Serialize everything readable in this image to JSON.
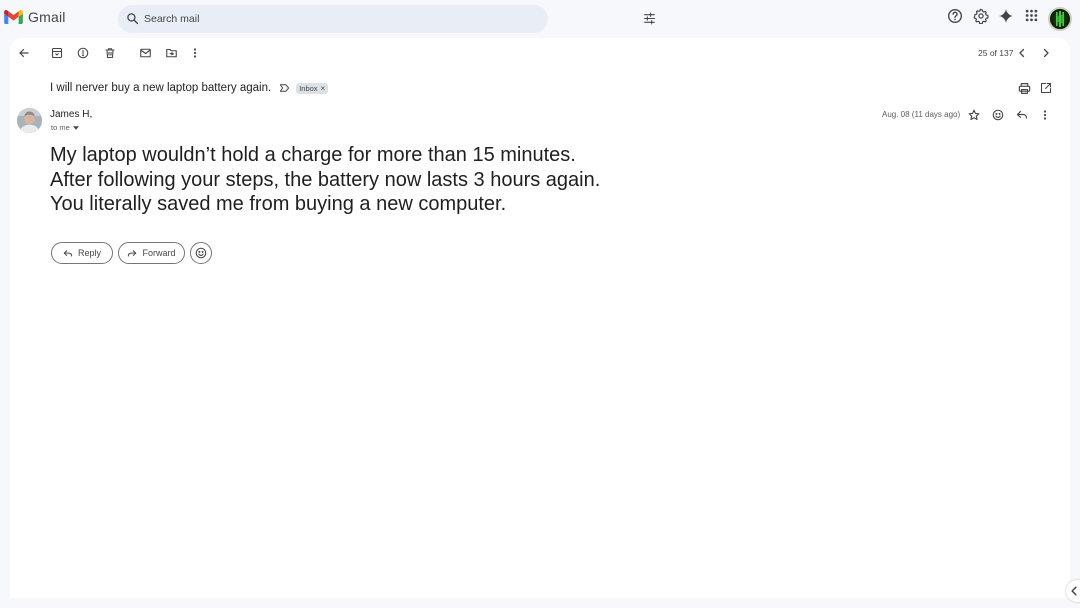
{
  "app": {
    "name": "Gmail"
  },
  "search": {
    "placeholder": "Search mail"
  },
  "topbar": {
    "icons": [
      "help-icon",
      "settings-icon",
      "gemini-sparkle-icon",
      "apps-grid-icon",
      "account-avatar"
    ]
  },
  "toolbar": {
    "icons": [
      "back-arrow-icon",
      "archive-icon",
      "report-spam-icon",
      "delete-icon",
      "mark-unread-icon",
      "move-to-icon",
      "more-vert-icon"
    ],
    "pager": "25 of 137"
  },
  "email": {
    "subject": "I will nerver buy a new laptop battery again.",
    "label": "Inbox",
    "label_remove": "×",
    "sender": "James H,",
    "recipient": "to me",
    "date": "Aug. 08 (11 days ago)",
    "body": [
      "My laptop wouldn’t hold a charge for more than 15 minutes.",
      "After following your steps, the battery now lasts 3 hours again.",
      "You literally saved me from buying a new computer."
    ]
  },
  "actions": {
    "reply": "Reply",
    "forward": "Forward"
  },
  "colors": {
    "background": "#f6f8fc",
    "panel": "#ffffff",
    "search_bg": "#e9eef6",
    "text": "#1f1f1f",
    "muted": "#444746",
    "gmail_red": "#ea4335",
    "gmail_blue": "#4285f4",
    "gmail_green": "#34a853",
    "gmail_yellow": "#fbbc04"
  }
}
